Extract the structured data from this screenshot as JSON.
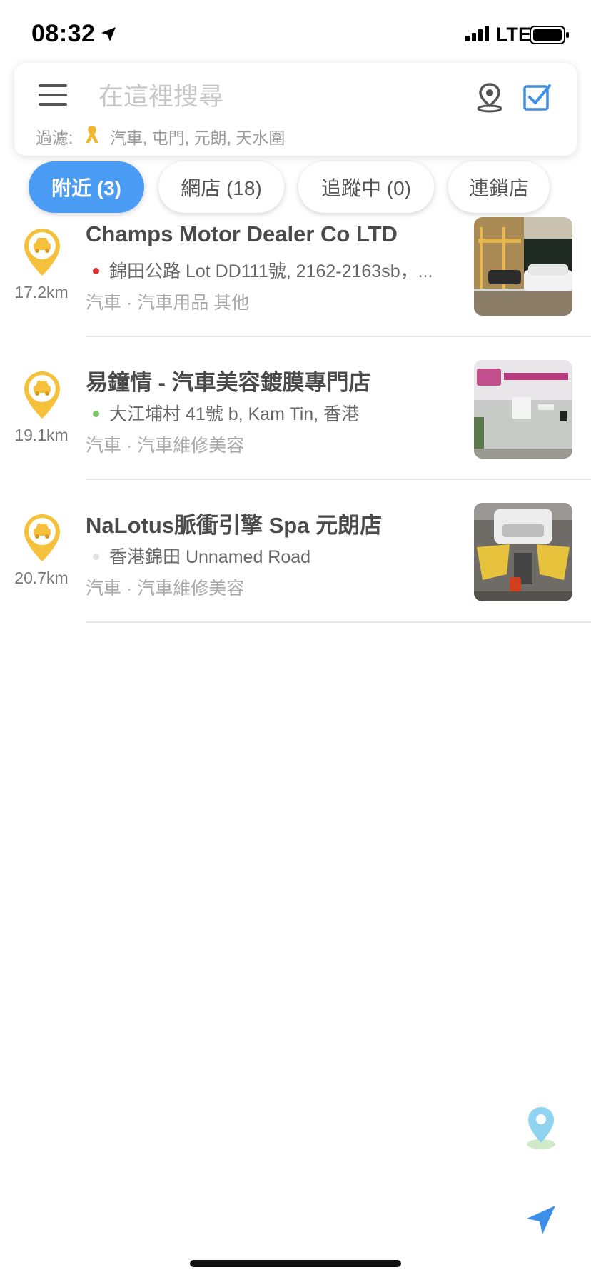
{
  "status_bar": {
    "time": "08:32",
    "network": "LTE"
  },
  "search": {
    "placeholder": "在這裡搜尋",
    "filter_label": "過濾:",
    "filter_value": "汽車, 屯門, 元朗, 天水圍"
  },
  "tabs": [
    {
      "label": "附近 (3)",
      "active": true
    },
    {
      "label": "網店 (18)",
      "active": false
    },
    {
      "label": "追蹤中 (0)",
      "active": false
    },
    {
      "label": "連鎖店",
      "active": false
    }
  ],
  "results": [
    {
      "title": "Champs Motor Dealer Co LTD",
      "address": "錦田公路 Lot DD111號, 2162-2163sb，...",
      "status_color": "#d9302b",
      "category": "汽車 · 汽車用品  其他",
      "distance": "17.2km",
      "marker_icon": "car-pin-icon",
      "thumbnail": "car-dealer-photo"
    },
    {
      "title": "易鐘情 - 汽車美容鍍膜專門店",
      "address": "大江埔村 41號 b, Kam Tin, 香港",
      "status_color": "#7cc36b",
      "category": "汽車 · 汽車維修美容",
      "distance": "19.1km",
      "marker_icon": "car-pin-icon",
      "thumbnail": "car-beauty-shop-photo"
    },
    {
      "title": "NaLotus脈衝引擎 Spa 元朗店",
      "address": "香港錦田 Unnamed Road",
      "status_color": "#e2e2e2",
      "category": "汽車 · 汽車維修美容",
      "distance": "20.7km",
      "marker_icon": "car-pin-icon",
      "thumbnail": "engine-spa-photo"
    }
  ],
  "colors": {
    "accent": "#4a9cf5",
    "marker": "#f5c13a",
    "title": "#4a4a4a"
  }
}
